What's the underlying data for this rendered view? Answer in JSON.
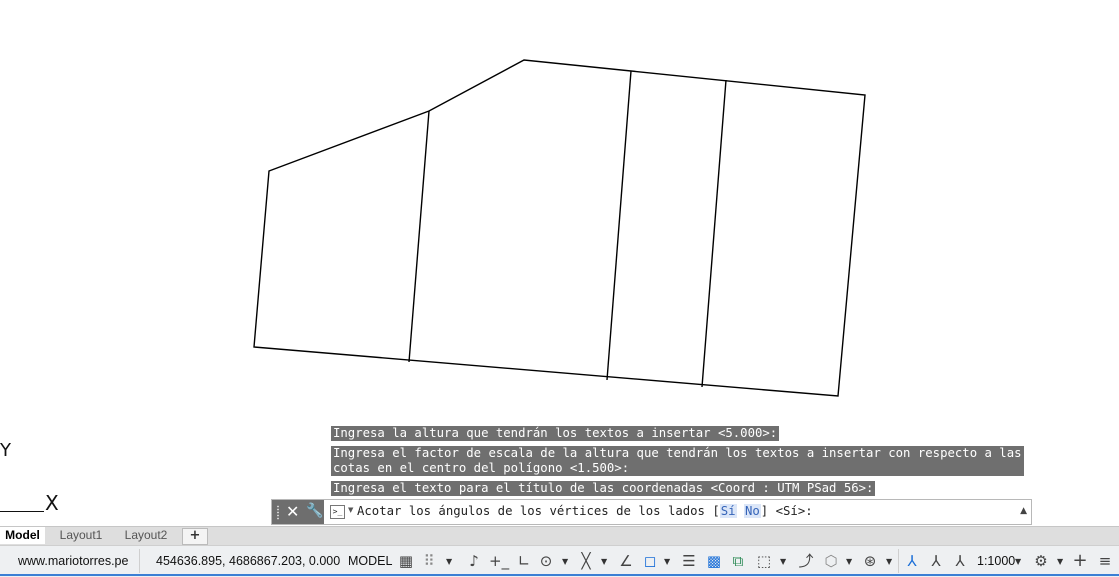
{
  "ucs": {
    "y_label": "Y",
    "x_label": "X"
  },
  "command_history": [
    "Ingresa la altura que tendrán los textos a insertar <5.000>:",
    "Ingresa el factor de escala de la altura que tendrán los textos a insertar con respecto a las",
    "cotas en el centro del polígono <1.500>:",
    "Ingresa el texto para el título de las coordenadas <Coord : UTM PSad 56>:"
  ],
  "command_line": {
    "close_icon": "close-icon",
    "customize_icon": "wrench-icon",
    "prompt_icon_text": ">_",
    "prompt_before": "Acotar los ángulos de los vértices de los lados [",
    "option_yes": "Sí",
    "option_no": "No",
    "prompt_after": "] <Sí>:"
  },
  "tabs": [
    {
      "label": "Model",
      "active": true
    },
    {
      "label": "Layout1",
      "active": false
    },
    {
      "label": "Layout2",
      "active": false
    }
  ],
  "tab_add_label": "+",
  "statusbar": {
    "watermark": "www.mariotorres.pe",
    "coordinates": "454636.895, 4686867.203, 0.000",
    "space": "MODEL",
    "annotation_scale": "1:1000",
    "accent_color": "#1b6fd8"
  }
}
